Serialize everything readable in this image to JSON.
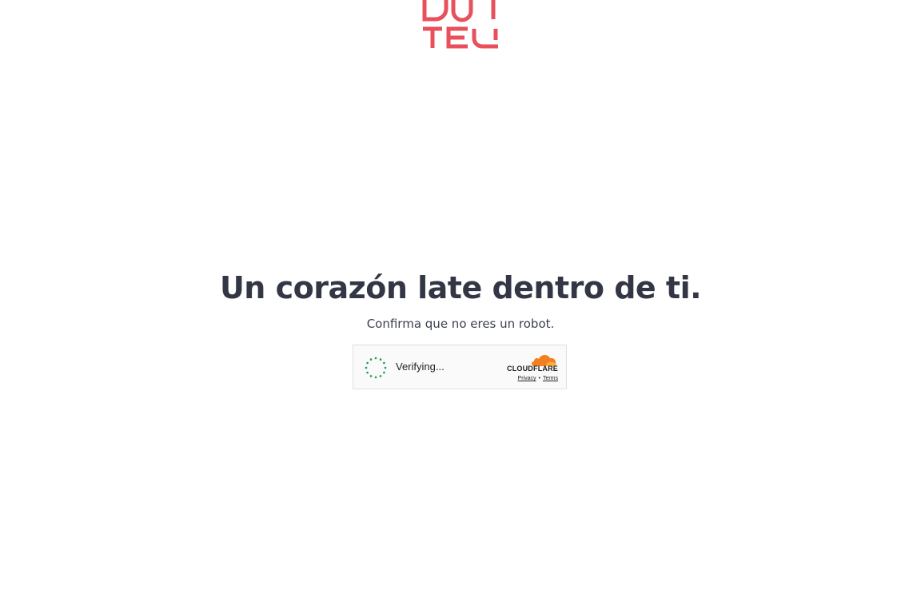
{
  "logo": {
    "name": "dot-tev-logo",
    "color": "#e8505b"
  },
  "main": {
    "headline": "Un corazón late dentro de ti.",
    "subline": "Confirma que no eres un robot."
  },
  "captcha": {
    "status": "Verifying...",
    "brand": "CLOUDFLARE",
    "privacy_label": "Privacy",
    "separator": "•",
    "terms_label": "Terms",
    "spinner_color": "#1a9a4a",
    "cloud_color": "#f38020"
  }
}
